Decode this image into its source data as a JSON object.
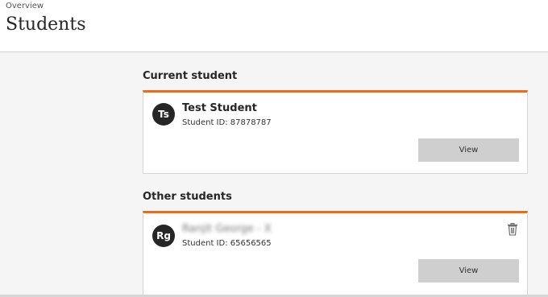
{
  "header": {
    "breadcrumb": "Overview",
    "title": "Students"
  },
  "current_section": {
    "heading": "Current student",
    "student": {
      "initials": "Ts",
      "name": "Test Student",
      "id_text": "Student ID: 87878787",
      "view_label": "View"
    }
  },
  "other_section": {
    "heading": "Other students",
    "students": [
      {
        "initials": "Rg",
        "name": "Ranjit George - X",
        "id_text": "Student ID: 65656565",
        "view_label": "View",
        "delete_icon": "trash-icon"
      }
    ]
  },
  "colors": {
    "accent": "#eb6b18",
    "button_bg": "#cfcfcf",
    "avatar_bg": "#262626"
  }
}
